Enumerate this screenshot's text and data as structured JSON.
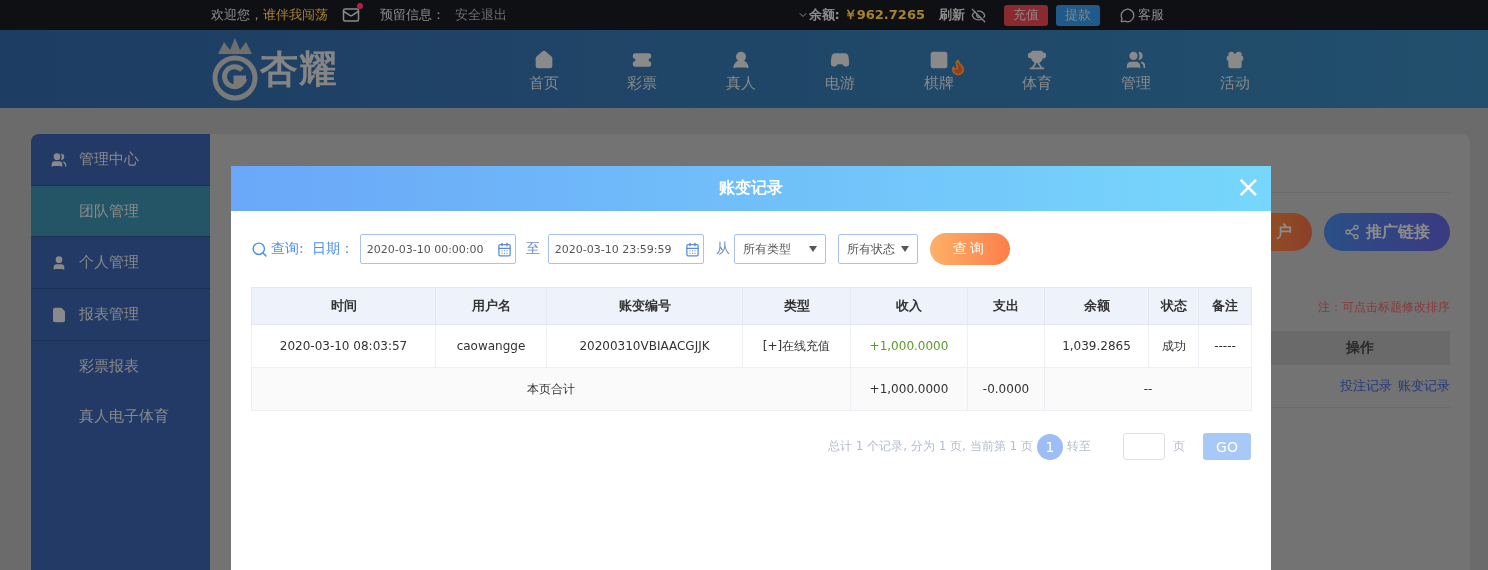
{
  "top_bar": {
    "welcome": "欢迎您，",
    "username": "谁伴我闯荡",
    "mail_unread": true,
    "reserved": "预留信息：",
    "logout": "安全退出",
    "balance_label": "余额:",
    "balance": "￥962.7265",
    "refresh": "刷新",
    "recharge": "充值",
    "withdraw": "提款",
    "service": "客服"
  },
  "logo": {
    "text": "杏耀"
  },
  "nav": [
    {
      "label": "首页",
      "hot": false
    },
    {
      "label": "彩票",
      "hot": false
    },
    {
      "label": "真人",
      "hot": false
    },
    {
      "label": "电游",
      "hot": false
    },
    {
      "label": "棋牌",
      "hot": true
    },
    {
      "label": "体育",
      "hot": false
    },
    {
      "label": "管理",
      "hot": false
    },
    {
      "label": "活动",
      "hot": false
    }
  ],
  "sidebar": [
    {
      "label": "管理中心",
      "selected": false,
      "children": [
        {
          "label": "团队管理",
          "selected": true
        }
      ]
    },
    {
      "label": "个人管理",
      "selected": false
    },
    {
      "label": "报表管理",
      "selected": false,
      "children": [
        {
          "label": "彩票报表",
          "selected": false
        },
        {
          "label": "真人电子体育",
          "selected": false
        }
      ]
    }
  ],
  "page": {
    "actions": [
      "户",
      "推广链接"
    ],
    "note": "注：可点击标题修改排序",
    "table_column": "操作",
    "row_links": [
      "投注记录",
      "账变记录"
    ]
  },
  "modal": {
    "title": "账变记录",
    "close": "×",
    "query": {
      "label": "查询:",
      "date_label": "日期：",
      "start": "2020-03-10 00:00:00",
      "to": "至",
      "end": "2020-03-10 23:59:59",
      "from": "从",
      "type_select": "所有类型",
      "status_select": "所有状态",
      "button": "查询"
    },
    "table": {
      "columns": [
        "时间",
        "用户名",
        "账变编号",
        "类型",
        "收入",
        "支出",
        "余额",
        "状态",
        "备注"
      ],
      "rows": [
        [
          "2020-03-10 08:03:57",
          "caowangge",
          "20200310VBIAACGJJK",
          "[+]在线充值",
          "+1,000.0000",
          "",
          "1,039.2865",
          "成功",
          "-----"
        ]
      ],
      "summary": {
        "label": "本页合计",
        "income": "+1,000.0000",
        "expense": "-0.0000",
        "rest": "--"
      }
    },
    "pagination": {
      "summary": "总计 1 个记录, 分为 1 页, 当前第 1 页",
      "pages": [
        {
          "label": "1",
          "selected": true
        }
      ],
      "goto": "转至",
      "unit": "页",
      "button": "GO"
    }
  }
}
